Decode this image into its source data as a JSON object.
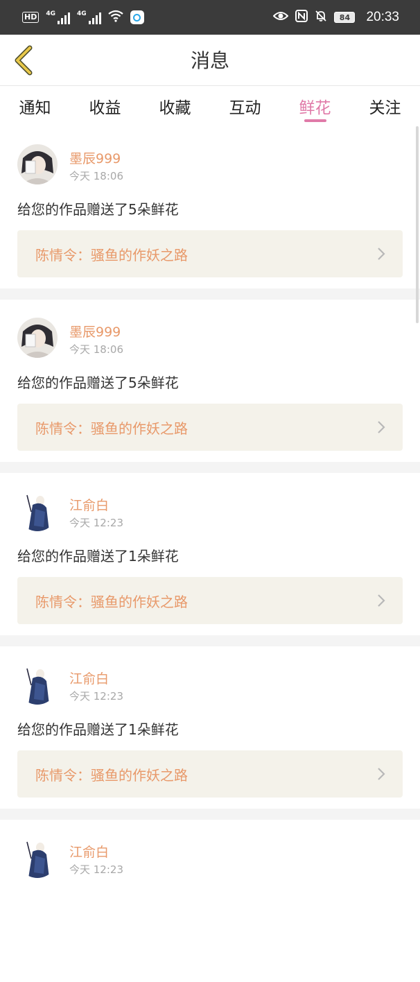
{
  "status_bar": {
    "hd_label": "HD",
    "net_label_1": "4G",
    "net_label_2": "4G",
    "battery": "84",
    "time": "20:33"
  },
  "header": {
    "title": "消息",
    "back_icon": "chevron-left-icon"
  },
  "tabs": [
    {
      "label": "通知"
    },
    {
      "label": "收益"
    },
    {
      "label": "收藏"
    },
    {
      "label": "互动"
    },
    {
      "label": "鲜花",
      "active": true
    },
    {
      "label": "关注"
    }
  ],
  "colors": {
    "accent_pink": "#e07aa8",
    "name_orange": "#e8996a",
    "work_bg": "#f4f2ea"
  },
  "messages": [
    {
      "user": "墨辰999",
      "time": "今天 18:06",
      "text": "给您的作品赠送了5朵鲜花",
      "work": "陈情令：骚鱼的作妖之路",
      "avatar": "avatar-1"
    },
    {
      "user": "墨辰999",
      "time": "今天 18:06",
      "text": "给您的作品赠送了5朵鲜花",
      "work": "陈情令：骚鱼的作妖之路",
      "avatar": "avatar-1"
    },
    {
      "user": "江俞白",
      "time": "今天 12:23",
      "text": "给您的作品赠送了1朵鲜花",
      "work": "陈情令：骚鱼的作妖之路",
      "avatar": "avatar-2"
    },
    {
      "user": "江俞白",
      "time": "今天 12:23",
      "text": "给您的作品赠送了1朵鲜花",
      "work": "陈情令：骚鱼的作妖之路",
      "avatar": "avatar-2"
    },
    {
      "user": "江俞白",
      "time": "今天 12:23"
    }
  ]
}
